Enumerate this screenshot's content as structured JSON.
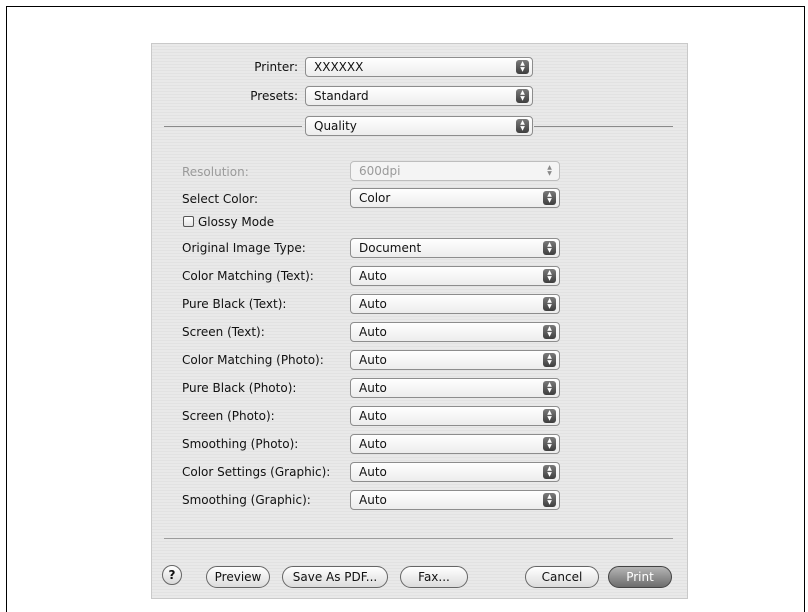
{
  "dialog": {
    "printer": {
      "label": "Printer:",
      "value": "XXXXXX"
    },
    "presets": {
      "label": "Presets:",
      "value": "Standard"
    },
    "panel": {
      "value": "Quality"
    }
  },
  "settings": {
    "resolution": {
      "label": "Resolution:",
      "value": "600dpi",
      "enabled": false
    },
    "select_color": {
      "label": "Select Color:",
      "value": "Color"
    },
    "glossy_mode": {
      "label": "Glossy Mode",
      "checked": false
    },
    "rows": [
      {
        "label": "Original Image Type:",
        "value": "Document"
      },
      {
        "label": "Color Matching (Text):",
        "value": "Auto"
      },
      {
        "label": "Pure Black (Text):",
        "value": "Auto"
      },
      {
        "label": "Screen (Text):",
        "value": "Auto"
      },
      {
        "label": "Color Matching (Photo):",
        "value": "Auto"
      },
      {
        "label": "Pure Black (Photo):",
        "value": "Auto"
      },
      {
        "label": "Screen (Photo):",
        "value": "Auto"
      },
      {
        "label": "Smoothing (Photo):",
        "value": "Auto"
      },
      {
        "label": "Color Settings (Graphic):",
        "value": "Auto"
      },
      {
        "label": "Smoothing (Graphic):",
        "value": "Auto"
      }
    ]
  },
  "buttons": {
    "help": "?",
    "preview": "Preview",
    "save_pdf": "Save As PDF...",
    "fax": "Fax...",
    "cancel": "Cancel",
    "print": "Print"
  },
  "icons": {
    "popup_arrows": "up-down-arrows-icon"
  }
}
